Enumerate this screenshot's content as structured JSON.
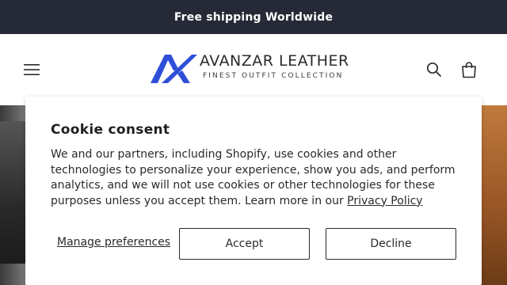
{
  "announcement": {
    "text": "Free shipping Worldwide"
  },
  "header": {
    "menu_icon": "hamburger-menu-icon",
    "logo": {
      "name": "AVANZAR LEATHER",
      "tagline": "FINEST OUTFIT COLLECTION",
      "brand_color": "#2f4fd8"
    },
    "search_icon": "search-icon",
    "cart_icon": "cart-icon"
  },
  "cookie_banner": {
    "title": "Cookie consent",
    "body": "We and our partners, including Shopify, use cookies and other technologies to personalize your experience, show you ads, and perform analytics, and we will not use cookies or other technologies for these purposes unless you accept them. Learn more in our ",
    "privacy_link": "Privacy Policy",
    "manage_label": "Manage preferences",
    "accept_label": "Accept",
    "decline_label": "Decline"
  },
  "colors": {
    "announcement_bg": "#252a36",
    "text": "#2a2a2a"
  }
}
